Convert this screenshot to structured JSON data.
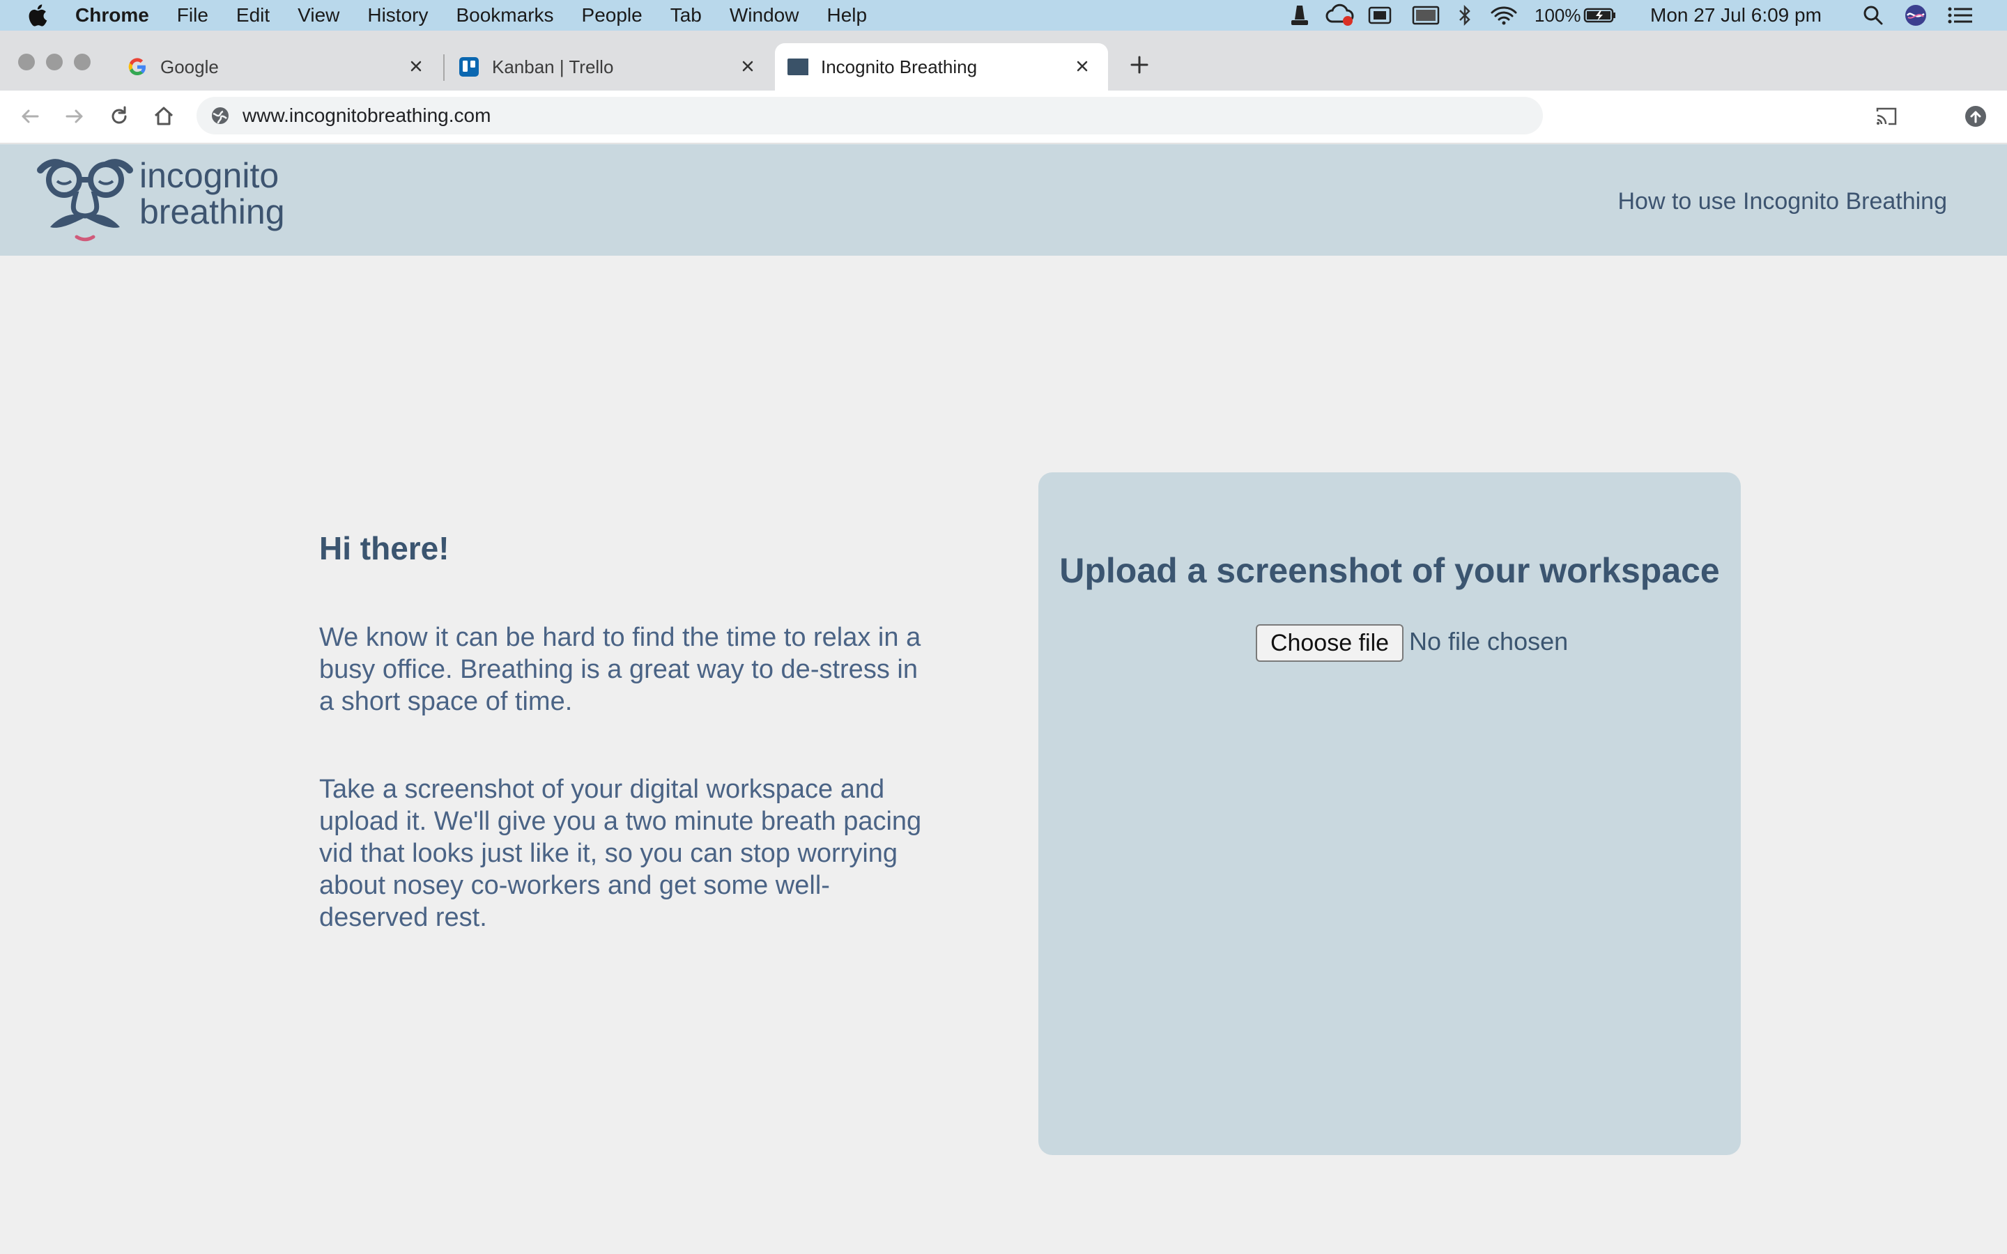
{
  "menubar": {
    "items": [
      "Chrome",
      "File",
      "Edit",
      "View",
      "History",
      "Bookmarks",
      "People",
      "Tab",
      "Window",
      "Help"
    ],
    "battery": "100%",
    "clock": "Mon 27 Jul  6:09 pm"
  },
  "tabs": [
    {
      "title": "Google",
      "icon": "google-icon",
      "active": false
    },
    {
      "title": "Kanban | Trello",
      "icon": "trello-icon",
      "active": false
    },
    {
      "title": "Incognito Breathing",
      "icon": "site-icon",
      "active": true
    }
  ],
  "toolbar": {
    "url": "www.incognitobreathing.com"
  },
  "site": {
    "logo_line1": "incognito",
    "logo_line2": "breathing",
    "nav_link": "How to use Incognito Breathing"
  },
  "main": {
    "greeting": "Hi there!",
    "paragraph1": "We know it can be hard to find the time to relax in a busy office. Breathing is a great way to de-stress in a short space of time.",
    "paragraph2": "Take a screenshot of your digital workspace and upload it. We'll give you a two minute breath pacing vid that looks just like it, so you can stop worrying about nosey co-workers and get some well-deserved rest."
  },
  "upload": {
    "title": "Upload a screenshot of your workspace",
    "button_label": "Choose file",
    "status": "No file chosen"
  },
  "colors": {
    "menubar_bg": "#b9d8eb",
    "header_bg": "#c9d8df",
    "page_bg": "#efefef",
    "text_primary": "#3b5570"
  }
}
